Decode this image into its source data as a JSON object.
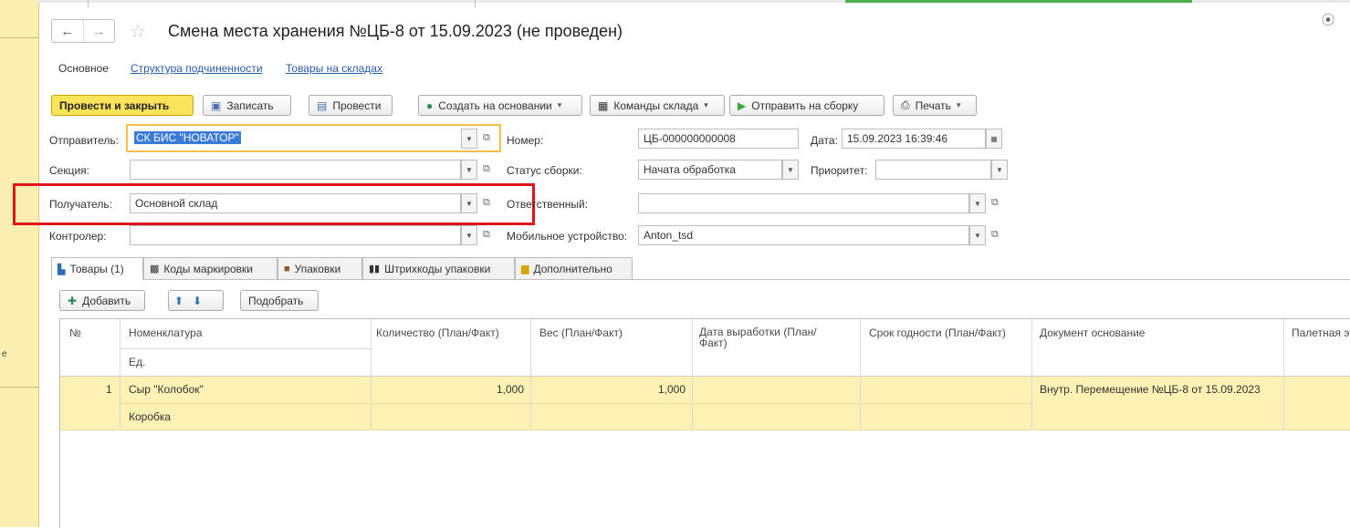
{
  "window": {
    "title": "Смена места хранения №ЦБ-8 от 15.09.2023 (не проведен)"
  },
  "left_strip": {
    "fragment": "е"
  },
  "nav": {
    "back": "←",
    "forward": "→"
  },
  "subtabs": [
    "Основное",
    "Структура подчиненности",
    "Товары на складах"
  ],
  "toolbar": {
    "post_close": "Провести и закрыть",
    "save": "Записать",
    "post": "Провести",
    "create_based": "Создать на основании",
    "warehouse_commands": "Команды склада",
    "send_assembly": "Отправить на сборку",
    "print": "Печать"
  },
  "form": {
    "sender_label": "Отправитель:",
    "sender_value": "СК БИС \"НОВАТОР\"",
    "section_label": "Секция:",
    "section_value": "",
    "recipient_label": "Получатель:",
    "recipient_value": "Основной склад",
    "controller_label": "Контролер:",
    "controller_value": "",
    "number_label": "Номер:",
    "number_value": "ЦБ-000000000008",
    "date_label": "Дата:",
    "date_value": "15.09.2023 16:39:46",
    "assembly_status_label": "Статус сборки:",
    "assembly_status_value": "Начата обработка",
    "priority_label": "Приоритет:",
    "priority_value": "",
    "responsible_label": "Ответственный:",
    "responsible_value": "",
    "device_label": "Мобильное устройство:",
    "device_value": "Anton_tsd"
  },
  "tabs": [
    "Товары (1)",
    "Коды маркировки",
    "Упаковки",
    "Штрихкоды упаковки",
    "Дополнительно"
  ],
  "table_toolbar": {
    "add": "Добавить",
    "pick": "Подобрать"
  },
  "table": {
    "headers": {
      "num": "№",
      "nomenclature": "Номенклатура",
      "unit": "Ед.",
      "qty": "Количество (План/Факт)",
      "weight": "Вес (План/Факт)",
      "prod_date": "Дата выработки (План/Факт)",
      "expiry": "Срок годности  (План/Факт)",
      "base_doc": "Документ основание",
      "pallet": "Палетная э"
    },
    "rows": [
      {
        "num": "1",
        "nomenclature": "Сыр \"Колобок\"",
        "unit": "Коробка",
        "qty": "1,000",
        "weight": "1,000",
        "prod_date": "",
        "expiry": "",
        "base_doc": "Внутр. Перемещение №ЦБ-8 от 15.09.2023",
        "pallet": ""
      }
    ]
  },
  "colors": {
    "primary_button": "#fbe35a",
    "highlight_row": "#fdf1b4",
    "annotation_box": "#e0141b",
    "link": "#2a5ea8"
  }
}
